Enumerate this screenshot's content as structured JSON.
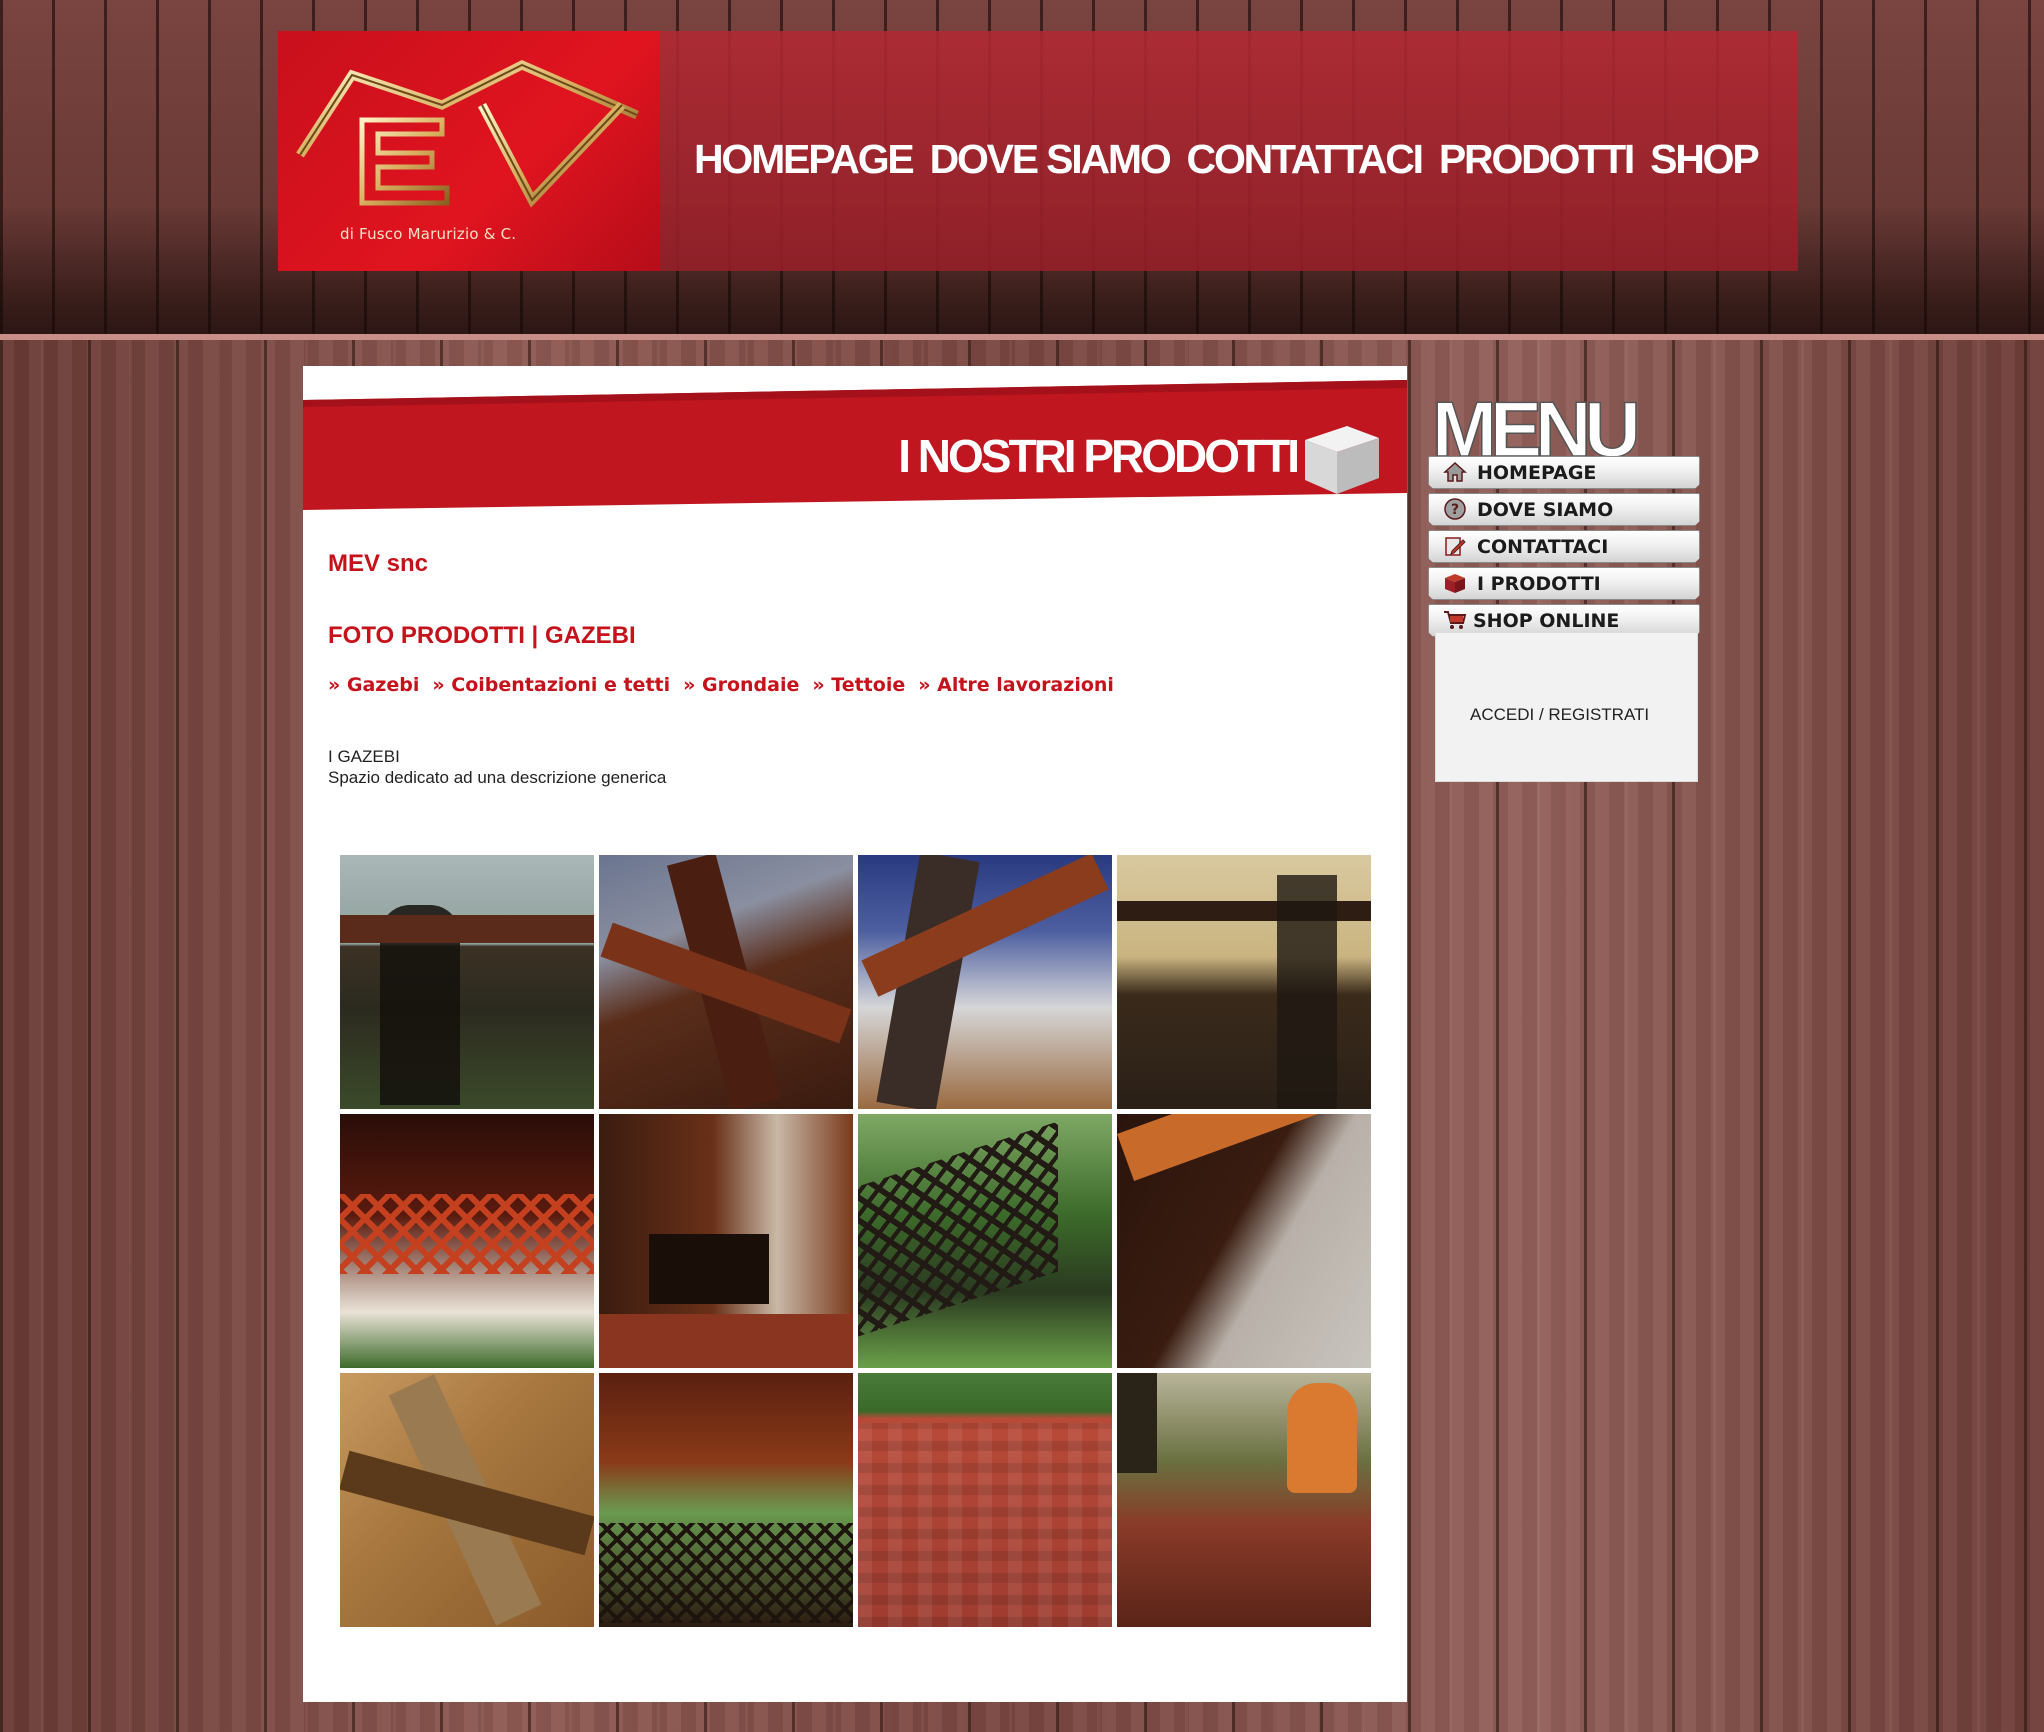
{
  "header": {
    "logo_text": "MEV",
    "logo_sub": "snc",
    "logo_tagline": "di Fusco Marurizio & C.",
    "nav": [
      "HOMEPAGE",
      "DOVE SIAMO",
      "CONTATTACI",
      "PRODOTTI",
      "SHOP"
    ]
  },
  "banner": {
    "title": "I NOSTRI PRODOTTI"
  },
  "content": {
    "company": "MEV snc",
    "section_title": "FOTO PRODOTTI | GAZEBI",
    "sub_nav": [
      "» Gazebi",
      "» Coibentazioni e tetti",
      "» Grondaie",
      "» Tettoie",
      "» Altre lavorazioni"
    ],
    "description_title": "I GAZEBI",
    "description_text": "Spazio dedicato ad una descrizione generica"
  },
  "gallery": {
    "count": 12
  },
  "side_menu": {
    "title": "MENU",
    "items": [
      {
        "label": "HOMEPAGE",
        "icon": "home-icon"
      },
      {
        "label": "DOVE SIAMO",
        "icon": "question-icon"
      },
      {
        "label": "CONTATTACI",
        "icon": "edit-icon"
      },
      {
        "label": "I PRODOTTI",
        "icon": "box-icon"
      },
      {
        "label": "SHOP ONLINE",
        "icon": "cart-icon"
      }
    ],
    "login": "ACCEDI / REGISTRATI"
  },
  "colors": {
    "brand_red": "#c5121b",
    "header_red": "#b22832",
    "wood": "#7e4a44"
  }
}
